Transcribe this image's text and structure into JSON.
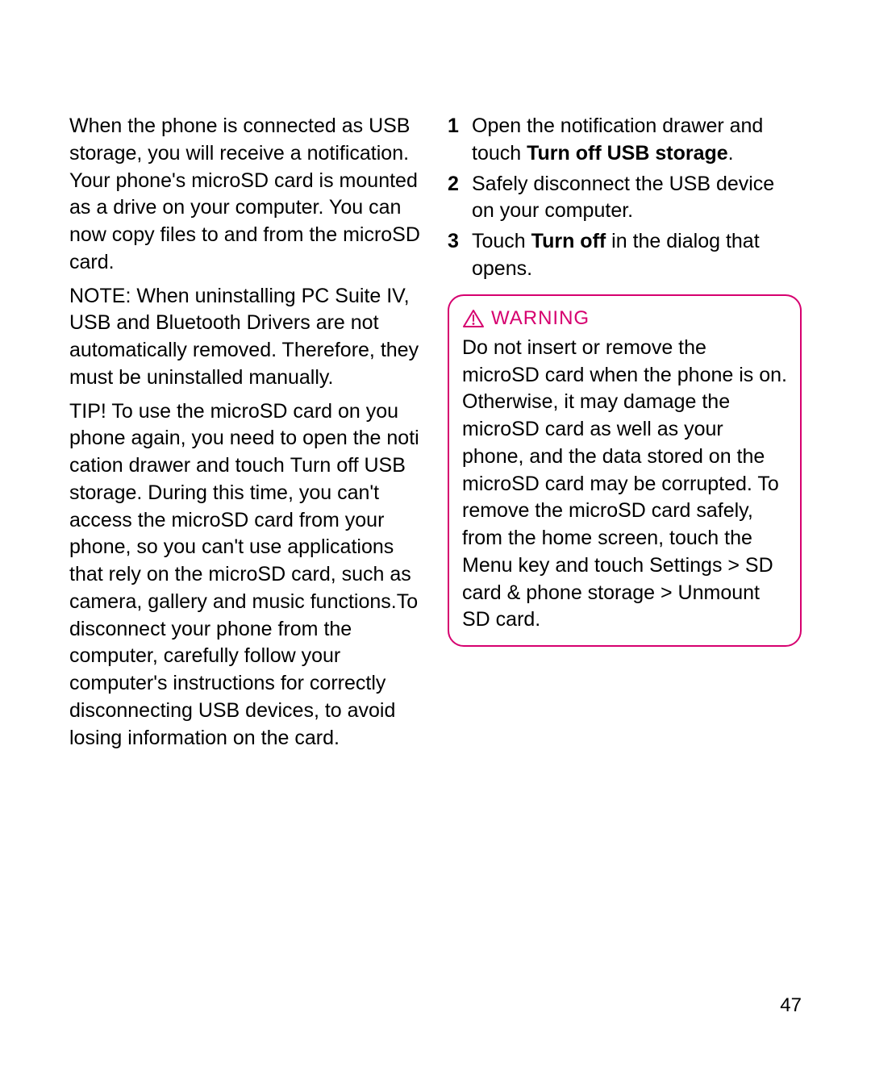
{
  "left": {
    "intro": "When the phone is connected as USB storage, you will receive a notification. Your phone's microSD card is mounted as a drive on your computer. You can now copy files to and from the microSD card.",
    "note_label": "NOTE:",
    "note_text": " When uninstalling PC Suite IV, USB and Bluetooth Drivers are not automatically removed. Therefore, they must be uninstalled manually.",
    "tip_label": "TIP!",
    "tip_pre": "  To use the microSD card on you phone again, you need to open the noti cation drawer and touch ",
    "tip_inline1": "Turn off USB storage.",
    "tip_rest": " During this time, you can't access the microSD card from your phone, so you can't use applications that rely on the microSD card, such as camera, gallery and music functions.To disconnect your phone from the computer, carefully follow your computer's instructions for correctly disconnecting USB devices, to avoid losing information on the card."
  },
  "right": {
    "steps": [
      {
        "num": "1",
        "pre": "Open the notification drawer and touch ",
        "bold": "Turn off USB storage",
        "post": "."
      },
      {
        "num": "2",
        "pre": "Safely disconnect the USB device on your computer.",
        "bold": "",
        "post": ""
      },
      {
        "num": "3",
        "pre": "Touch ",
        "bold": "Turn off",
        "post": " in the dialog that opens."
      }
    ],
    "warning_label": "WARNING",
    "warning_p1": "Do not insert or remove the microSD card when the phone is on. Otherwise, it may damage the microSD card as well as your phone, and the data stored on the microSD card may be corrupted. To remove the microSD card safely, from the home screen, touch the ",
    "warning_menu": "Menu",
    "warning_p2": " key and touch ",
    "warning_settings": "Settings > SD card & phone storage > Unmount SD card."
  },
  "page_number": "47"
}
